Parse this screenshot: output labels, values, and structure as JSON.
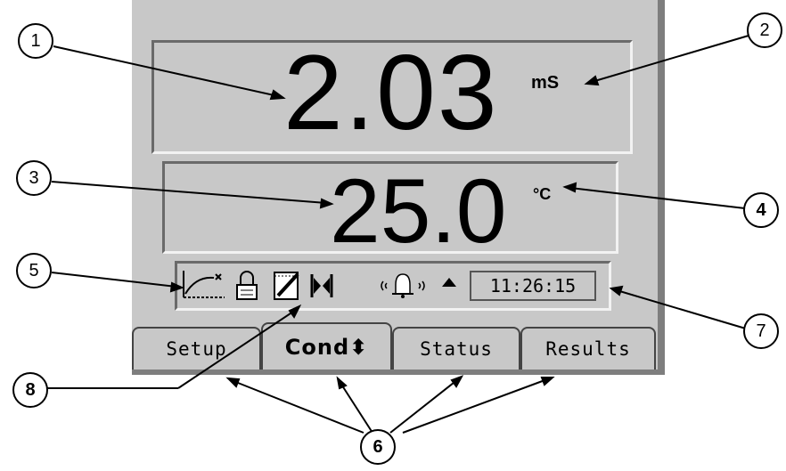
{
  "display": {
    "main_value": "2.03",
    "main_unit": "mS",
    "temp_value": "25.0",
    "temp_unit": "°C",
    "clock": "11:26:15"
  },
  "tabs": [
    {
      "label": "Setup"
    },
    {
      "label": "Cond⬍"
    },
    {
      "label": "Status"
    },
    {
      "label": "Results"
    }
  ],
  "status_icons": [
    "graph-icon",
    "lock-icon",
    "notepad-pen-icon",
    "stability-icon",
    "alarm-bell-icon",
    "arrow-up-icon"
  ],
  "callouts": [
    "1",
    "2",
    "3",
    "4",
    "5",
    "6",
    "7",
    "8"
  ]
}
